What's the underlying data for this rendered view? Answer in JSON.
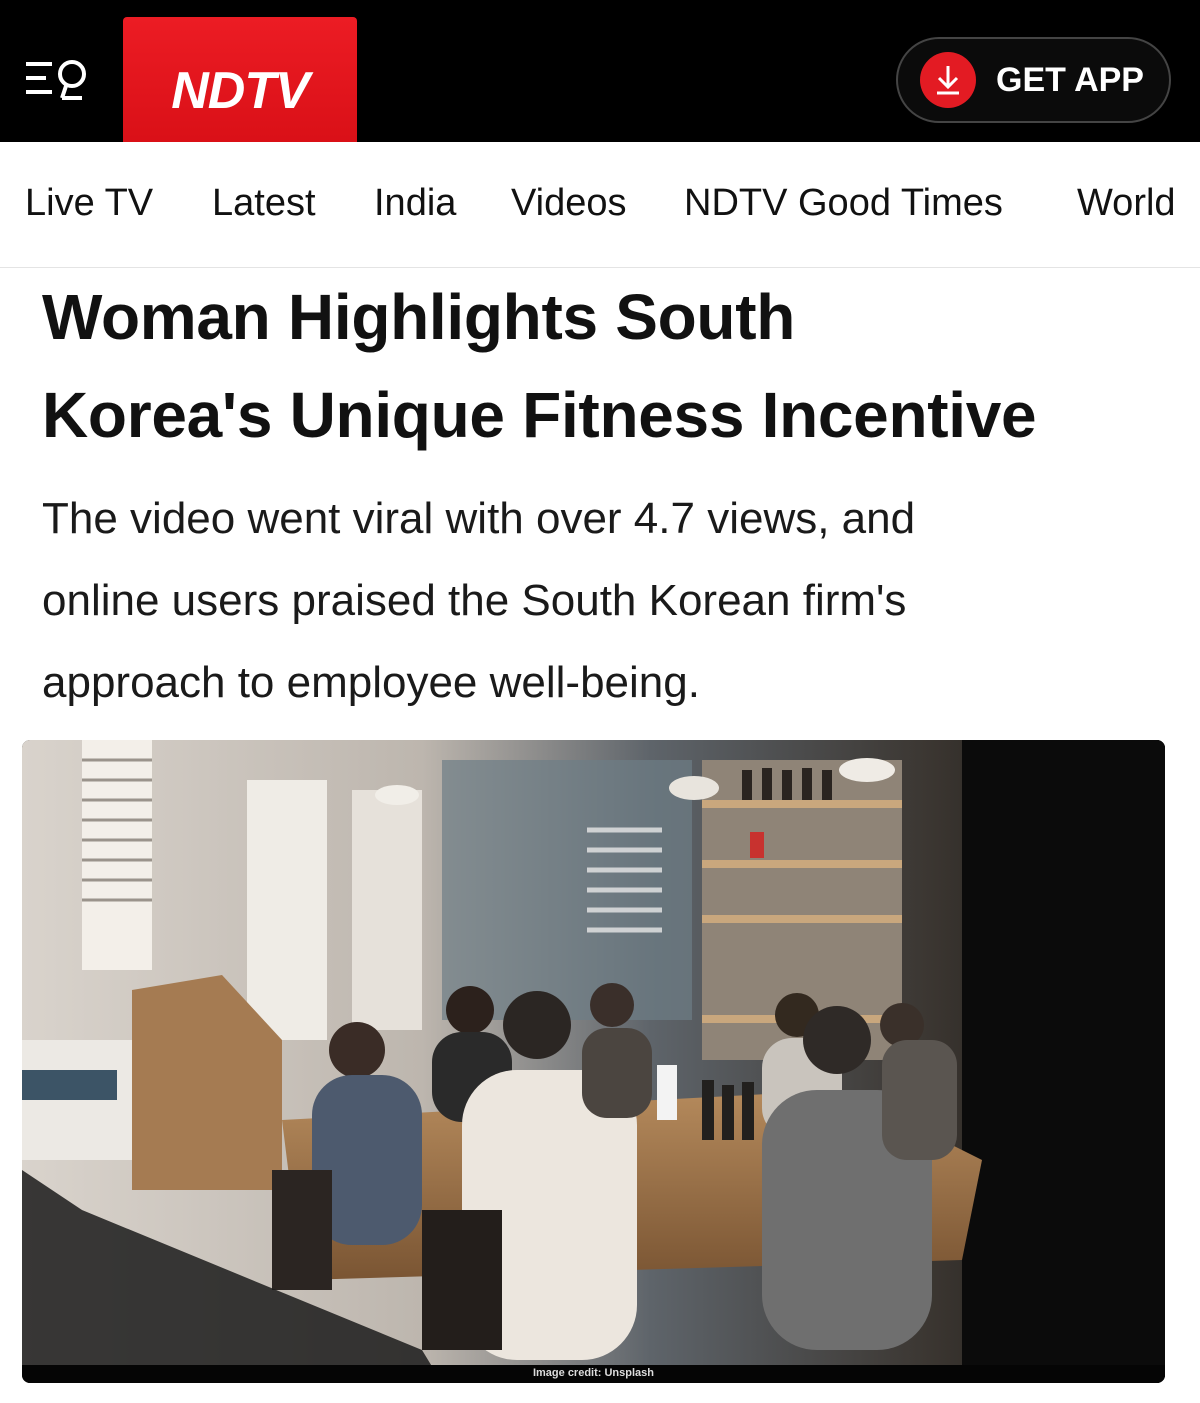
{
  "header": {
    "logo_text": "NDTV",
    "get_app_label": "GET APP",
    "brand_color": "#e31b23"
  },
  "nav": {
    "items": [
      "Live TV",
      "Latest",
      "India",
      "Videos",
      "NDTV Good Times",
      "World"
    ]
  },
  "article": {
    "headline_line1": "Woman Highlights South",
    "headline_line2": "Korea's Unique Fitness Incentive",
    "summary_line1": "The video went viral with over 4.7 views, and",
    "summary_line2": "online users praised the South Korean firm's",
    "summary_line3": "approach to employee well-being.",
    "image_credit": "Image credit: Unsplash"
  }
}
